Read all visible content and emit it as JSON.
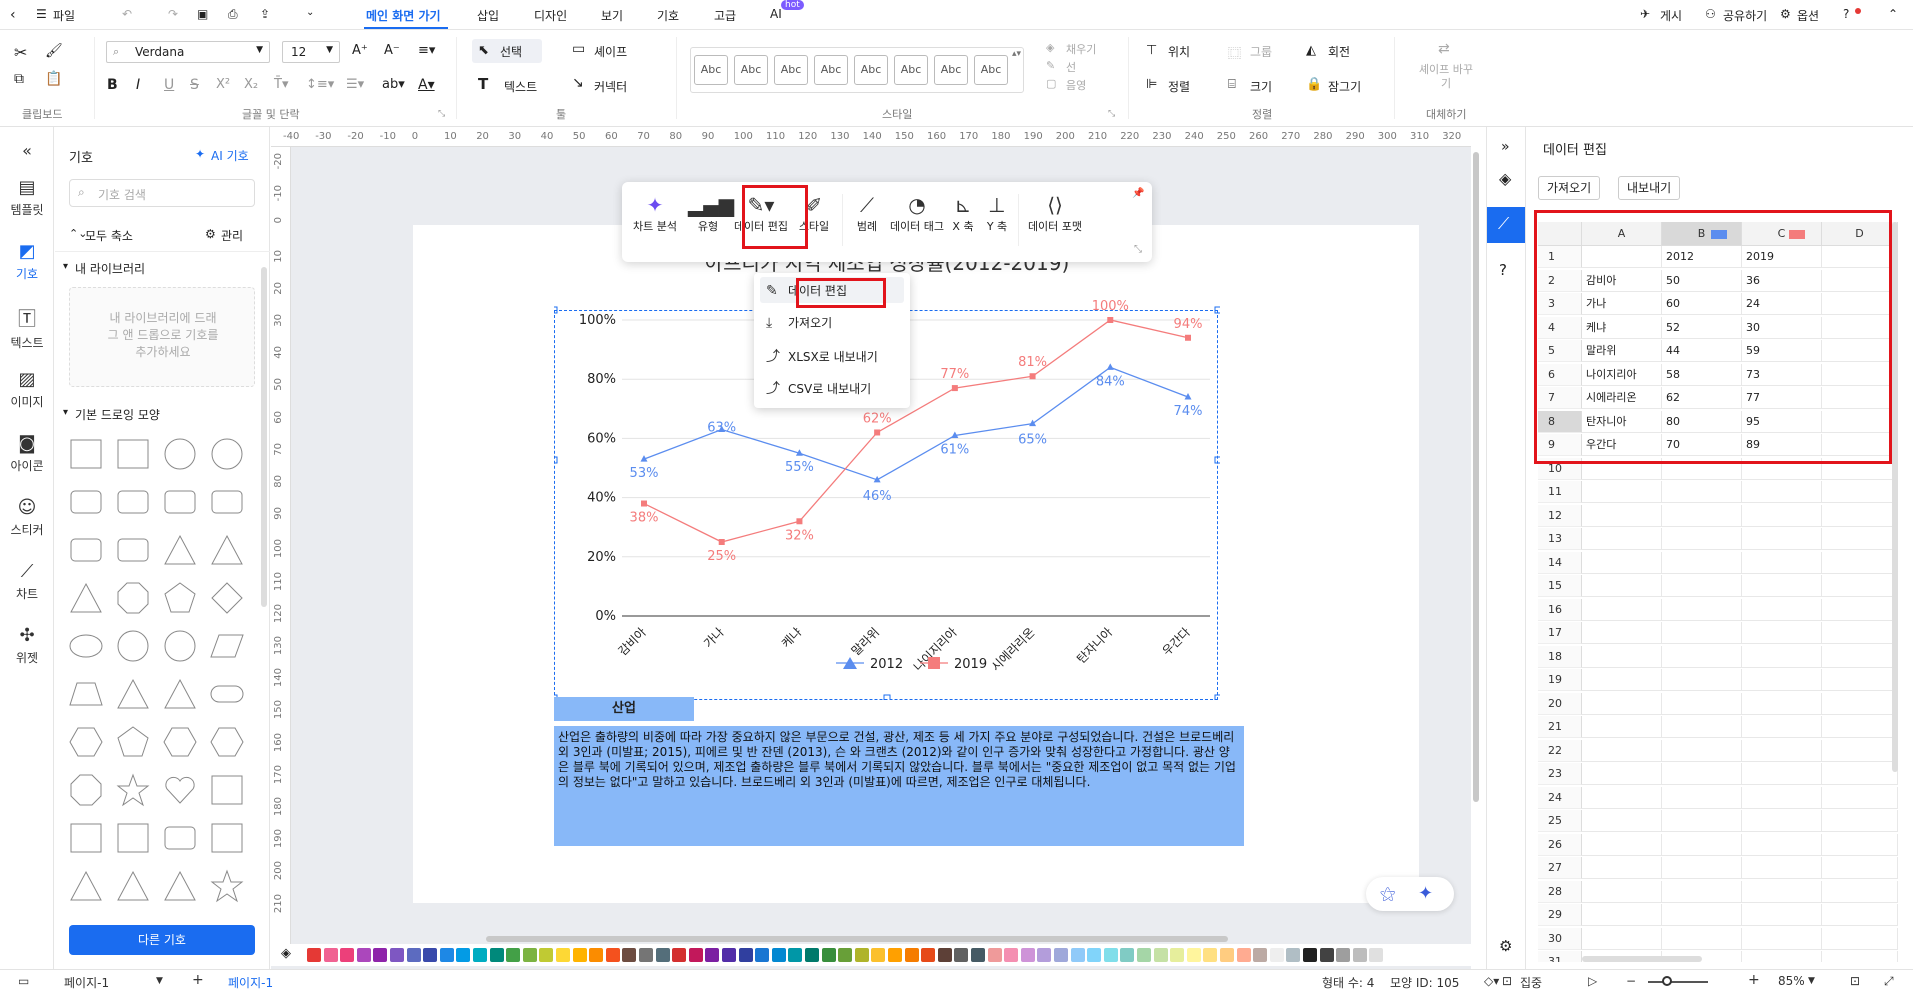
{
  "menu": {
    "file": "파일",
    "tabs": [
      "메인 화면 가기",
      "삽입",
      "디자인",
      "보기",
      "기호",
      "고급",
      "AI"
    ],
    "hot_badge": "hot",
    "right": {
      "publish": "게시",
      "share": "공유하기",
      "options": "옵션"
    }
  },
  "ribbon": {
    "font_name": "Verdana",
    "font_size": "12",
    "select": "선택",
    "shape": "셰이프",
    "text": "텍스트",
    "connector": "커넥터",
    "style_samples": [
      "Abc",
      "Abc",
      "Abc",
      "Abc",
      "Abc",
      "Abc",
      "Abc",
      "Abc"
    ],
    "fill": "채우기",
    "line": "선",
    "shadow": "음영",
    "position": "위치",
    "group": "그룹",
    "rotate": "회전",
    "align": "정렬",
    "size": "크기",
    "lock": "잠그기",
    "replace_shape": "셰이프 바꾸기",
    "group_labels": {
      "clipboard": "클립보드",
      "font_paragraph": "글꼴 및 단락",
      "tools": "툴",
      "style": "스타일",
      "arrange": "정렬",
      "replace": "대체하기"
    }
  },
  "rail": {
    "items": [
      "템플릿",
      "기호",
      "텍스트",
      "이미지",
      "아이콘",
      "스티커",
      "차트",
      "위젯"
    ]
  },
  "symbols": {
    "title": "기호",
    "ai_symbols": "AI 기호",
    "search_placeholder": "기호 검색",
    "collapse_all": "모두 축소",
    "manage": "관리",
    "my_library": "내 라이브러리",
    "drop_hint": "내 라이브러리에 드래그 앤 드롭으로 기호를 추가하세요",
    "basic_shapes": "기본 드로잉 모양",
    "more_symbols": "다른 기호"
  },
  "ruler": {
    "h": [
      "-40",
      "-30",
      "-20",
      "-10",
      "0",
      "10",
      "20",
      "30",
      "40",
      "50",
      "60",
      "70",
      "80",
      "90",
      "100",
      "110",
      "120",
      "130",
      "140",
      "150",
      "160",
      "170",
      "180",
      "190",
      "200",
      "210",
      "220",
      "230",
      "240",
      "250",
      "260",
      "270",
      "280",
      "290",
      "300",
      "310",
      "320"
    ],
    "v": [
      "-20",
      "-10",
      "0",
      "10",
      "20",
      "30",
      "40",
      "50",
      "60",
      "70",
      "80",
      "90",
      "100",
      "110",
      "120",
      "130",
      "140",
      "150",
      "160",
      "170",
      "180",
      "190",
      "200",
      "210"
    ]
  },
  "float_toolbar": {
    "items": [
      "차트 분석",
      "유형",
      "데이터 편집",
      "스타일",
      "범례",
      "데이터 태그",
      "X 축",
      "Y 축",
      "데이터 포맷"
    ]
  },
  "dropdown": {
    "items": [
      "데이터 편집",
      "가져오기",
      "XLSX로 내보내기",
      "CSV로 내보내기"
    ]
  },
  "chart_data": {
    "type": "line",
    "title": "아프리카 지역 제조업 성장률(2012-2019)",
    "categories": [
      "감비아",
      "가나",
      "케냐",
      "말라위",
      "나이지리아",
      "시에라리온",
      "탄자니아",
      "우간다"
    ],
    "series": [
      {
        "name": "2012",
        "values": [
          53,
          63,
          55,
          46,
          61,
          65,
          84,
          74
        ],
        "color": "#5b8def"
      },
      {
        "name": "2019",
        "values": [
          38,
          25,
          32,
          62,
          77,
          81,
          100,
          94
        ],
        "color": "#f47c7c"
      }
    ],
    "yticks": [
      "0%",
      "20%",
      "40%",
      "60%",
      "80%",
      "100%"
    ],
    "ylim": [
      0,
      100
    ],
    "grid": true,
    "legend": "bottom"
  },
  "textblock": {
    "heading": "산업",
    "body": "산업은 출하량의 비중에 따라 가장 중요하지 않은 부문으로 건설, 광산, 제조 등 세 가지 주요 분야로 구성되었습니다. 건설은 브로드베리 외 3인과 (미발표; 2015), 피에르 및 반 잔덴 (2013), 슨 와 크랜츠 (2012)와 같이 인구 증가와 맞춰 성장한다고 가정합니다. 광산 양은 블루 북에 기록되어 있으며, 제조업 출하량은 블루 북에서 기록되지 않았습니다. 블루 북에서는 \"중요한 제조업이 없고 목적 없는 기업의 정보는 없다\"고 말하고 있습니다. 브로드베리 외 3인과 (미발표)에 따르면, 제조업은 인구로 대체됩니다."
  },
  "data_panel": {
    "title": "데이터 편집",
    "import": "가져오기",
    "export": "내보내기",
    "columns": [
      "A",
      "B",
      "C",
      "D"
    ],
    "series_colors": [
      "#5b8def",
      "#f47c7c"
    ],
    "rows": [
      [
        "",
        "2012",
        "2019",
        ""
      ],
      [
        "감비아",
        "50",
        "36",
        ""
      ],
      [
        "가나",
        "60",
        "24",
        ""
      ],
      [
        "케냐",
        "52",
        "30",
        ""
      ],
      [
        "말라위",
        "44",
        "59",
        ""
      ],
      [
        "나이지리아",
        "58",
        "73",
        ""
      ],
      [
        "시에라리온",
        "62",
        "77",
        ""
      ],
      [
        "탄자니아",
        "80",
        "95",
        ""
      ],
      [
        "우간다",
        "70",
        "89",
        ""
      ]
    ],
    "row_numbers": [
      "1",
      "2",
      "3",
      "4",
      "5",
      "6",
      "7",
      "8",
      "9",
      "10",
      "11",
      "12",
      "13",
      "14",
      "15",
      "16",
      "17",
      "18",
      "19",
      "20",
      "21",
      "22",
      "23",
      "24",
      "25",
      "26",
      "27",
      "28",
      "29",
      "30",
      "31"
    ]
  },
  "status": {
    "page_select": "페이지-1",
    "page_tab": "페이지-1",
    "shape_count": "형태 수: 4",
    "shape_id": "모양 ID: 105",
    "focus": "집중",
    "zoom": "85%"
  },
  "palette": [
    "#e53935",
    "#f06292",
    "#ec407a",
    "#ab47bc",
    "#8e24aa",
    "#7e57c2",
    "#5c6bc0",
    "#3949ab",
    "#1e88e5",
    "#039be5",
    "#00acc1",
    "#00897b",
    "#43a047",
    "#7cb342",
    "#c0ca33",
    "#fdd835",
    "#ffb300",
    "#fb8c00",
    "#f4511e",
    "#6d4c41",
    "#757575",
    "#546e7a",
    "#d32f2f",
    "#c2185b",
    "#7b1fa2",
    "#512da8",
    "#303f9f",
    "#1976d2",
    "#0288d1",
    "#0097a7",
    "#00796b",
    "#388e3c",
    "#689f38",
    "#afb42b",
    "#fbc02d",
    "#ffa000",
    "#f57c00",
    "#e64a19",
    "#5d4037",
    "#616161",
    "#455a64",
    "#ef9a9a",
    "#f48fb1",
    "#ce93d8",
    "#b39ddb",
    "#9fa8da",
    "#90caf9",
    "#81d4fa",
    "#80deea",
    "#80cbc4",
    "#a5d6a7",
    "#c5e1a5",
    "#e6ee9c",
    "#fff59d",
    "#ffe082",
    "#ffcc80",
    "#ffab91",
    "#bcaaa4",
    "#eeeeee",
    "#b0bec5",
    "#212121",
    "#424242",
    "#9e9e9e",
    "#bdbdbd",
    "#e0e0e0"
  ]
}
